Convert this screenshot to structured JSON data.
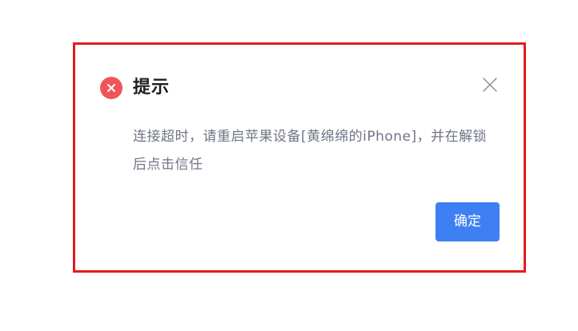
{
  "dialog": {
    "title": "提示",
    "message": "连接超时，请重启苹果设备[黄绵绵的iPhone]，并在解锁后点击信任",
    "confirm_label": "确定",
    "icons": {
      "status": "error-circle-icon",
      "close": "close-icon"
    }
  },
  "colors": {
    "highlight_border": "#e31c1c",
    "error_icon": "#f0545a",
    "primary_button": "#3e80f3",
    "message_text": "#6f7486"
  }
}
